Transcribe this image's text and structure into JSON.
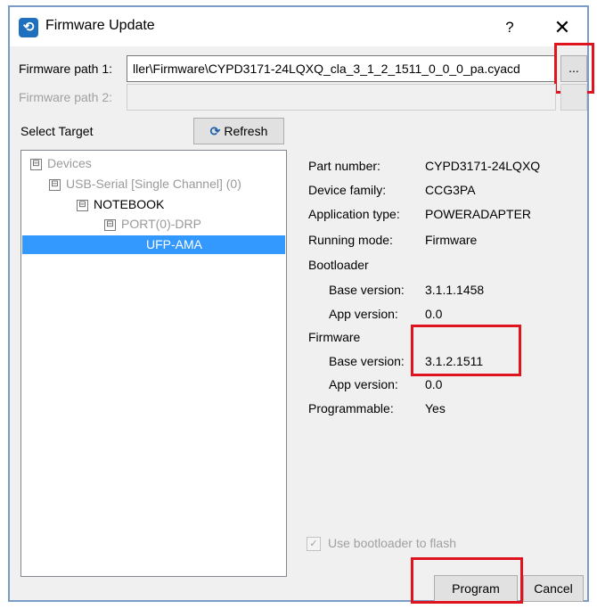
{
  "window": {
    "title": "Firmware Update",
    "help": "?",
    "close": "✕",
    "icon": "app-icon"
  },
  "firmware": {
    "path1_label": "Firmware path 1:",
    "path1_value": "ller\\Firmware\\CYPD3171-24LQXQ_cla_3_1_2_1511_0_0_0_pa.cyacd",
    "browse_label": "...",
    "path2_label": "Firmware path 2:",
    "path2_value": ""
  },
  "target": {
    "label": "Select Target",
    "refresh_label": "Refresh",
    "tree": [
      {
        "label": "Devices",
        "expander": "⊟"
      },
      {
        "label": "USB-Serial [Single Channel] (0)",
        "expander": "⊟"
      },
      {
        "label": "NOTEBOOK",
        "expander": "⊟"
      },
      {
        "label": "PORT(0)-DRP",
        "expander": "⊟"
      },
      {
        "label": "UFP-AMA",
        "expander": ""
      }
    ]
  },
  "info": {
    "part_number_label": "Part number:",
    "part_number": "CYPD3171-24LQXQ",
    "device_family_label": "Device family:",
    "device_family": "CCG3PA",
    "app_type_label": "Application type:",
    "app_type": "POWERADAPTER",
    "running_mode_label": "Running mode:",
    "running_mode": "Firmware",
    "bootloader_label": "Bootloader",
    "bl_base_label": "Base version:",
    "bl_base": "3.1.1.1458",
    "bl_app_label": "App version:",
    "bl_app": "0.0",
    "firmware_label": "Firmware",
    "fw_base_label": "Base version:",
    "fw_base": "3.1.2.1511",
    "fw_app_label": "App version:",
    "fw_app": "0.0",
    "programmable_label": "Programmable:",
    "programmable": "Yes"
  },
  "options": {
    "use_bootloader_label": "Use bootloader to flash",
    "use_bootloader_checked": true
  },
  "buttons": {
    "program": "Program",
    "cancel": "Cancel"
  },
  "colors": {
    "highlight": "#e0141e",
    "selection": "#3399ff"
  }
}
